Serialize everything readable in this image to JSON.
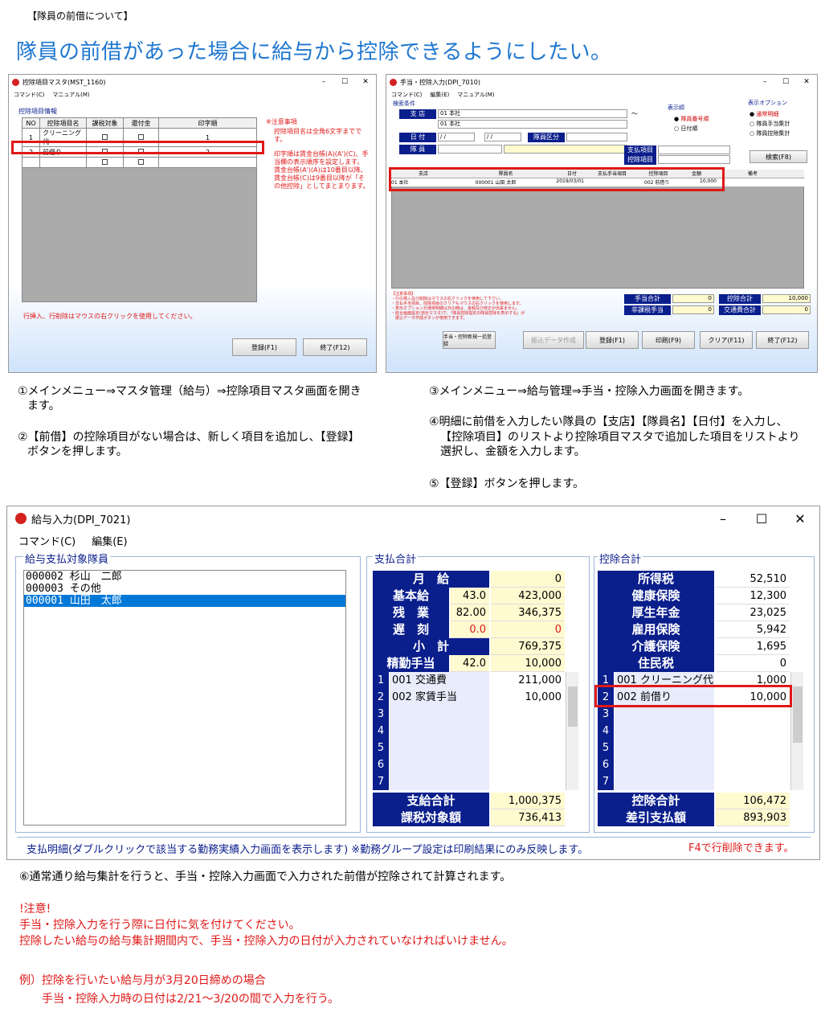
{
  "header": {
    "tag": "【隊員の前借について】",
    "headline": "隊員の前借があった場合に給与から控除できるようにしたい。"
  },
  "win1": {
    "title": "控除項目マスタ(MST_1160)",
    "controls": [
      "–",
      "☐",
      "✕"
    ],
    "menu": [
      "コマンド(C)",
      "マニュアル(M)"
    ],
    "section": "控除項目情報",
    "columns": [
      "NO",
      "控除項目名",
      "課税対象",
      "還付金",
      "印字順"
    ],
    "rows": [
      {
        "no": "1",
        "name": "クリーニング代",
        "order": "1"
      },
      {
        "no": "2",
        "name": "前借り",
        "order": "2"
      },
      {
        "no": "",
        "name": "",
        "order": ""
      }
    ],
    "notes": [
      "※注意事項",
      "控除項目名は全角6文字までです。",
      "印字順は賃金台帳(A)(A')(C)、手当欄の表示順序を設定します。",
      "賃金台帳(A')(A)は10番目以降、賃金台帳(C)は9番目以降が「その他控除」としてまとまります。"
    ],
    "hint": "行挿入、行削除はマウスの右クリックを使用してください。",
    "buttons": [
      "登録(F1)",
      "終了(F12)"
    ]
  },
  "win2": {
    "title": "手当・控除入力(DPI_7010)",
    "controls": [
      "–",
      "☐",
      "✕"
    ],
    "menu": [
      "コマンド(C)",
      "編集(E)",
      "マニュアル(M)"
    ],
    "search_label": "検索条件",
    "branch_label": "支 店",
    "branch_from": "01 本社",
    "branch_to": "01 本社",
    "tilde": "〜",
    "date_label": "日 付",
    "date_from": "/ /",
    "date_to": "/ /",
    "class_label": "隊員区分",
    "member_label": "隊 員",
    "sort_label": "表示順",
    "sort_options": [
      "隊員番号順",
      "日付順"
    ],
    "display_label": "表示オプション",
    "display_options": [
      "通常明細",
      "隊員手当集計",
      "隊員控除集計"
    ],
    "pay_label": "支払項目",
    "deduct_label": "控除項目",
    "search_btn": "検索(F8)",
    "grid_headers": [
      "支店",
      "隊員名",
      "日付",
      "支払手当項目",
      "控除項目",
      "金額",
      "備考"
    ],
    "grid_row": {
      "branch": "01 本社",
      "member": "000001 山田 太郎",
      "date": "2019/03/01",
      "deduct": "002 前借り",
      "amount": "10,000"
    },
    "notes": [
      "【注意事項】",
      "・行の挿入及び削除はマウスの右クリックを使用して下さい。",
      "・支払手当項目、控除項目のクリアもマウスの右クリックを使用します。",
      "・表示オプションが通常明細以外の時は、金額及び修正が出来ません。",
      "・総合画面設定(自社マスタ)で、「隊員控除指定の隊員控除を表示する」が",
      "　振込データ作成ボタンが使用できます。"
    ],
    "totals": [
      {
        "label": "手当合計",
        "value": "0"
      },
      {
        "label": "控除合計",
        "value": "10,000"
      },
      {
        "label": "非課税手当",
        "value": "0"
      },
      {
        "label": "交通費合計",
        "value": "0"
      }
    ],
    "buttons": [
      "手当・控除新規一括登録",
      "振込データ作成",
      "登録(F1)",
      "印刷(F9)",
      "クリア(F11)",
      "終了(F12)"
    ]
  },
  "steps": {
    "s1": "①メインメニュー⇒マスタ管理（給与）⇒控除項目マスタ画面を開き",
    "s1b": "ます。",
    "s2": "②【前借】の控除項目がない場合は、新しく項目を追加し、【登録】",
    "s2b": "ボタンを押します。",
    "s3": "③メインメニュー⇒給与管理⇒手当・控除入力画面を開きます。",
    "s4": "④明細に前借を入力したい隊員の【支店】【隊員名】【日付】を入力し、",
    "s4b": "【控除項目】のリストより控除項目マスタで追加した項目をリストより",
    "s4c": "選択し、金額を入力します。",
    "s5": "⑤【登録】ボタンを押します。"
  },
  "win3": {
    "title": "給与入力(DPI_7021)",
    "controls": [
      "–",
      "☐",
      "✕"
    ],
    "menu": [
      "コマンド(C)",
      "編集(E)"
    ],
    "left_title": "給与支払対象隊員",
    "members": [
      "000002 杉山　二郎",
      "000003 その他",
      "000001 山田　太郎"
    ],
    "pay_title": "支払合計",
    "pay_rows": [
      {
        "label": "月　給",
        "mid": "",
        "value": "0"
      },
      {
        "label": "基本給",
        "mid": "43.0",
        "value": "423,000"
      },
      {
        "label": "残　業",
        "mid": "82.00",
        "value": "346,375"
      },
      {
        "label": "遅　刻",
        "mid": "0.0",
        "value": "0"
      },
      {
        "label": "小　計",
        "mid": "",
        "value": "769,375"
      },
      {
        "label": "精勤手当",
        "mid": "42.0",
        "value": "10,000"
      }
    ],
    "pay_items": [
      {
        "no": "1",
        "name": "001 交通費",
        "value": "211,000"
      },
      {
        "no": "2",
        "name": "002 家賃手当",
        "value": "10,000"
      },
      {
        "no": "3",
        "name": "",
        "value": ""
      },
      {
        "no": "4",
        "name": "",
        "value": ""
      },
      {
        "no": "5",
        "name": "",
        "value": ""
      },
      {
        "no": "6",
        "name": "",
        "value": ""
      },
      {
        "no": "7",
        "name": "",
        "value": ""
      }
    ],
    "pay_total_label": "支給合計",
    "pay_total": "1,000,375",
    "taxable_label": "課税対象額",
    "taxable": "736,413",
    "ded_title": "控除合計",
    "ded_rows": [
      {
        "label": "所得税",
        "value": "52,510"
      },
      {
        "label": "健康保険",
        "value": "12,300"
      },
      {
        "label": "厚生年金",
        "value": "23,025"
      },
      {
        "label": "雇用保険",
        "value": "5,942"
      },
      {
        "label": "介護保険",
        "value": "1,695"
      },
      {
        "label": "住民税",
        "value": "0"
      }
    ],
    "ded_items": [
      {
        "no": "1",
        "name": "001 クリーニング代",
        "value": "1,000"
      },
      {
        "no": "2",
        "name": "002 前借り",
        "value": "10,000"
      },
      {
        "no": "3",
        "name": "",
        "value": ""
      },
      {
        "no": "4",
        "name": "",
        "value": ""
      },
      {
        "no": "5",
        "name": "",
        "value": ""
      },
      {
        "no": "6",
        "name": "",
        "value": ""
      },
      {
        "no": "7",
        "name": "",
        "value": ""
      }
    ],
    "ded_total_label": "控除合計",
    "ded_total": "106,472",
    "net_label": "差引支払額",
    "net": "893,903",
    "detail_label": "支払明細(ダブルクリックで該当する勤務実績入力画面を表示します) ※勤務グループ設定は印刷結果にのみ反映します。",
    "f4_hint": "F4で行削除できます。"
  },
  "footer": {
    "s6": "⑥通常通り給与集計を行うと、手当・控除入力画面で入力された前借が控除されて計算されます。",
    "caution": "!注意!",
    "c1": "手当・控除入力を行う際に日付に気を付けてください。",
    "c2": "控除したい給与の給与集計期間内で、手当・控除入力の日付が入力されていなければいけません。",
    "ex1": "例）控除を行いたい給与月が3月20日締めの場合",
    "ex2": "手当・控除入力時の日付は2/21〜3/20の間で入力を行う。"
  }
}
